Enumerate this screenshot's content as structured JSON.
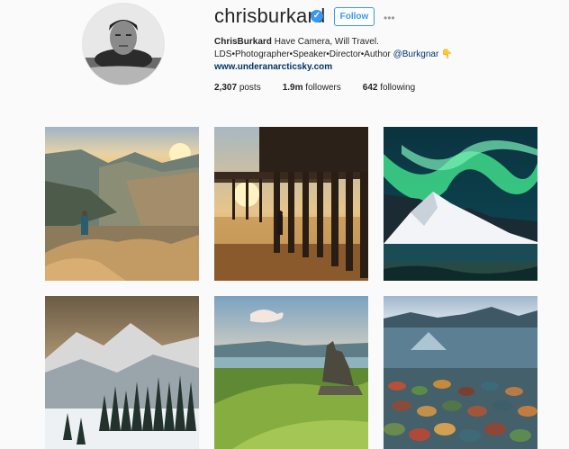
{
  "profile": {
    "username": "chrisburkard",
    "follow_label": "Follow",
    "more_glyph": "•••",
    "verified_glyph": "✓",
    "full_name": "ChrisBurkard",
    "bio_text": "Have Camera, Will Travel.",
    "bio_line2": "LDS•Photographer•Speaker•Director•Author ",
    "mention": "@Burkgnar",
    "hand_emoji": "👇",
    "website": "www.underanarcticsky.com"
  },
  "stats": {
    "posts_count": "2,307",
    "posts_label": "posts",
    "followers_count": "1.9m",
    "followers_label": "followers",
    "following_count": "642",
    "following_label": "following"
  },
  "colors": {
    "accent": "#3897f0",
    "link": "#003569",
    "background": "#fafafa"
  },
  "icons": {
    "verified": "verified-badge-icon",
    "more": "more-options-icon",
    "hand": "hand-pointing-icon"
  }
}
